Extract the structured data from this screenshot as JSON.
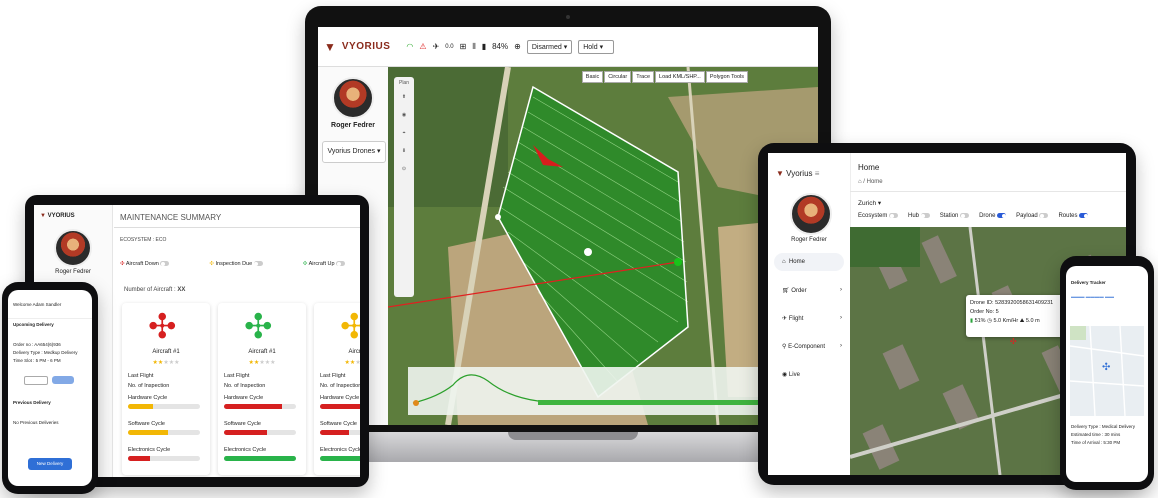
{
  "laptop": {
    "logo": "VYORIUS",
    "battery": "84%",
    "mode_select": "Disarmed",
    "hold_select": "Hold",
    "telemetry_small": "0.0",
    "user_name": "Roger Fedrer",
    "org_select": "Vyorius Drones",
    "map_tabs": [
      "Basic",
      "Circular",
      "Trace",
      "Load KML/SHP...",
      "Polygon Tools"
    ],
    "tools_header": "Plan"
  },
  "tablet_left": {
    "logo": "VYORIUS",
    "title": "MAINTENANCE SUMMARY",
    "ecosystem": "ECOSYSTEM : ECO",
    "user_name": "Roger Fedrer",
    "filters": [
      "Aircraft Down",
      "Inspection Due",
      "Aircraft Up"
    ],
    "aircraft_count_label": "Number of Aircraft :",
    "aircraft_count_value": "XX",
    "cards": [
      {
        "name": "Aircraft #1",
        "color": "#d62020",
        "bars": [
          0.35,
          0.55,
          0.3
        ],
        "bar_color": "#f2b705"
      },
      {
        "name": "Aircraft #1",
        "color": "#29b34a",
        "bars": [
          0.8,
          0.6,
          1.0
        ],
        "bar_color": "#d62020"
      },
      {
        "name": "Aircraft",
        "color": "#f2b705",
        "bars": [
          0.8,
          0.4,
          1.0
        ],
        "bar_color": "#d62020"
      }
    ],
    "card_labels": {
      "last_flight": "Last Flight",
      "inspection": "No. of Inspection",
      "hardware": "Hardware Cycle",
      "software": "Software Cycle",
      "electronics": "Electronics Cycle"
    }
  },
  "phone_left": {
    "welcome": "Welcome Adam Sandler",
    "upcoming": "Upcoming Delivery",
    "order_no": "Order no : AA654(6)936",
    "delivery_type": "Delivery Type : Medkup Delivery",
    "time_slot": "Time Slot : 5 PM - 6 PM",
    "previous": "Previous Delivery",
    "no_previous": "No Previous Deliveries",
    "new_delivery": "New Delivery"
  },
  "tablet_right": {
    "logo": "Vyorius",
    "page_title": "Home",
    "breadcrumb": "Home",
    "location": "Zurich",
    "toggles": [
      {
        "label": "Ecosystem",
        "on": false
      },
      {
        "label": "Hub",
        "on": false
      },
      {
        "label": "Station",
        "on": false
      },
      {
        "label": "Drone",
        "on": true
      },
      {
        "label": "Payload",
        "on": false
      },
      {
        "label": "Routes",
        "on": true
      }
    ],
    "user_name": "Roger Fedrer",
    "nav": [
      "Home",
      "Order",
      "Flight",
      "E-Component",
      "Live"
    ],
    "drone_popup": {
      "drone_id": "Drone ID: 5283920058631409231",
      "order_no": "Order No: 5",
      "battery": "51%",
      "speed": "5.0 Km/Hr",
      "altitude": "5.0 m"
    }
  },
  "phone_right": {
    "title": "Delivery Tracker",
    "delivery_type": "Delivery Type : Medical Delivery",
    "estimated": "Estimated time : 30 mins",
    "arrival": "Time of Arrival : 5:30 PM"
  }
}
